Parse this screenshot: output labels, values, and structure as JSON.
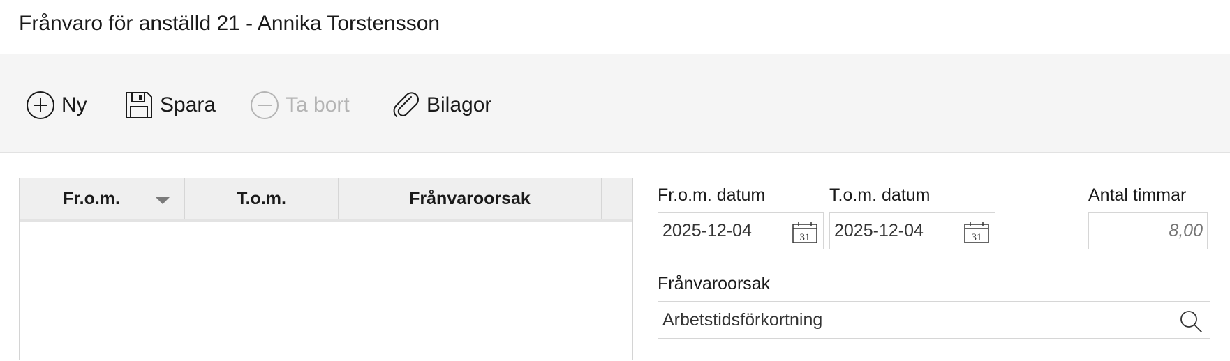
{
  "window": {
    "title": "Frånvaro för anställd 21 - Annika Torstensson"
  },
  "toolbar": {
    "new_label": "Ny",
    "save_label": "Spara",
    "delete_label": "Ta bort",
    "attachments_label": "Bilagor"
  },
  "grid": {
    "columns": [
      "Fr.o.m.",
      "T.o.m.",
      "Frånvaroorsak"
    ],
    "sorted_column": "Fr.o.m.",
    "rows": []
  },
  "form": {
    "from_date": {
      "label": "Fr.o.m. datum",
      "value": "2025-12-04",
      "calendar_day": "31"
    },
    "to_date": {
      "label": "T.o.m. datum",
      "value": "2025-12-04",
      "calendar_day": "31"
    },
    "hours": {
      "label": "Antal timmar",
      "placeholder": "8,00"
    },
    "reason": {
      "label": "Frånvaroorsak",
      "value": "Arbetstidsförkortning"
    }
  },
  "colors": {
    "toolbar_bg": "#f5f5f5",
    "header_bg": "#efefef",
    "disabled_text": "#b4b4b4",
    "border": "#d6d6d6"
  }
}
